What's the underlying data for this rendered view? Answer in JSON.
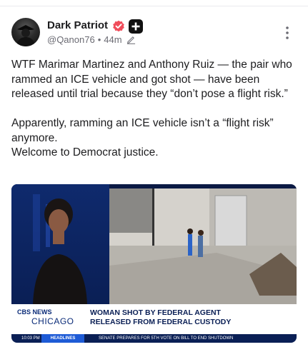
{
  "author": {
    "name": "Dark Patriot",
    "handle": "@Qanon76",
    "separator": "•",
    "time": "44m"
  },
  "post": {
    "text": "WTF Marimar Martinez and Anthony Ruiz — the pair who rammed an ICE vehicle and got shot — have been released until trial because they “don’t pose a flight risk.”\n\nApparently, ramming an ICE vehicle isn’t a “flight risk” anymore.\nWelcome to Democrat justice."
  },
  "media": {
    "logo_network": "CBS NEWS",
    "logo_city": "CHICAGO",
    "headline_1": "WOMAN SHOT BY FEDERAL AGENT",
    "headline_2": "RELEASED FROM FEDERAL CUSTODY",
    "ticker_time": "10:03 PM",
    "ticker_label": "HEADLINES",
    "ticker_crawl": "SENATE PREPARES FOR 5TH VOTE ON BILL TO END SHUTDOWN"
  },
  "colors": {
    "verified_badge": "#f04d5b",
    "plus_badge": "#111111",
    "news_navy": "#0a1f55",
    "news_blue": "#1e5bd6"
  },
  "icons": [
    "verified-badge-icon",
    "plus-badge-icon",
    "pencil-edit-icon",
    "more-vertical-icon"
  ]
}
